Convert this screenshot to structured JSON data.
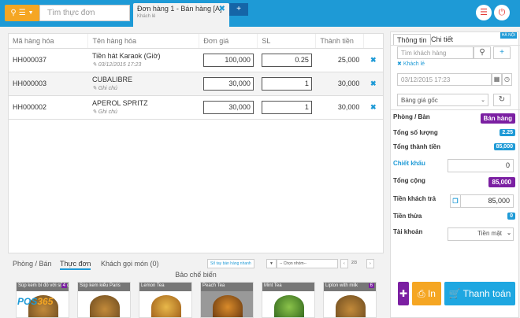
{
  "header": {
    "search_placeholder": "Tìm thực đơn",
    "tab_title": "Đơn hàng 1 - Bán hàng [A]",
    "tab_subtitle": "Khách lẻ",
    "add_tab": "+"
  },
  "table": {
    "headers": [
      "Mã hàng hóa",
      "Tên hàng hóa",
      "Đơn giá",
      "SL",
      "Thành tiền"
    ],
    "rows": [
      {
        "code": "HH000037",
        "name": "Tiền hát Karaok (Giờ)",
        "note": "03/12/2015 17:23",
        "price": "100,000",
        "qty": "0.25",
        "total": "25,000"
      },
      {
        "code": "HH000003",
        "name": "CUBALIBRE",
        "note": "Ghi chú",
        "price": "30,000",
        "qty": "1",
        "total": "30,000"
      },
      {
        "code": "HH000002",
        "name": "APEROL SPRITZ",
        "note": "Ghi chú",
        "price": "30,000",
        "qty": "1",
        "total": "30,000"
      }
    ]
  },
  "bottom": {
    "tabs": [
      "Phòng / Bán",
      "Thực đơn",
      "Khách gọi món (0)"
    ],
    "sales_book": "Sổ tay bán hàng nhanh",
    "group_select": "-- Chọn nhóm--",
    "page": "2/3",
    "category": "Bảo chế biến",
    "products": [
      {
        "name": "Súp kem bí đỏ với sữa dừa",
        "badge": "4"
      },
      {
        "name": "Súp kem kiểu Paris",
        "badge": ""
      },
      {
        "name": "Lemon Tea",
        "badge": ""
      },
      {
        "name": "Peach Tea",
        "badge": ""
      },
      {
        "name": "Mint Tea",
        "badge": ""
      },
      {
        "name": "Lipton with milk",
        "badge": "6"
      }
    ],
    "logo_a": "POS",
    "logo_b": "365"
  },
  "right": {
    "tab_info": "Thông tin",
    "tab_detail": "Chi tiết",
    "region": "HÀ NỘI",
    "customer_placeholder": "Tìm khách hàng",
    "customer_tag": "Khách lẻ",
    "datetime": "03/12/2015 17:23",
    "price_list": "Bảng giá gốc",
    "room_label": "Phòng / Bàn",
    "room_value": "Bán hàng",
    "qty_label": "Tổng số lượng",
    "qty_value": "2.25",
    "amount_label": "Tổng thành tiền",
    "amount_value": "85,000",
    "discount_label": "Chiết khấu",
    "discount_value": "0",
    "total_label": "Tổng cộng",
    "total_value": "85,000",
    "paid_label": "Tiền khách trả",
    "paid_value": "85,000",
    "change_label": "Tiền thừa",
    "change_value": "0",
    "account_label": "Tài khoản",
    "account_value": "Tiền mặt",
    "print_label": "In",
    "pay_label": "Thanh toán"
  },
  "colors": {
    "primary": "#1e9ad6",
    "accent": "#f5a623",
    "purple": "#7b1fa2",
    "danger": "#e53935"
  }
}
